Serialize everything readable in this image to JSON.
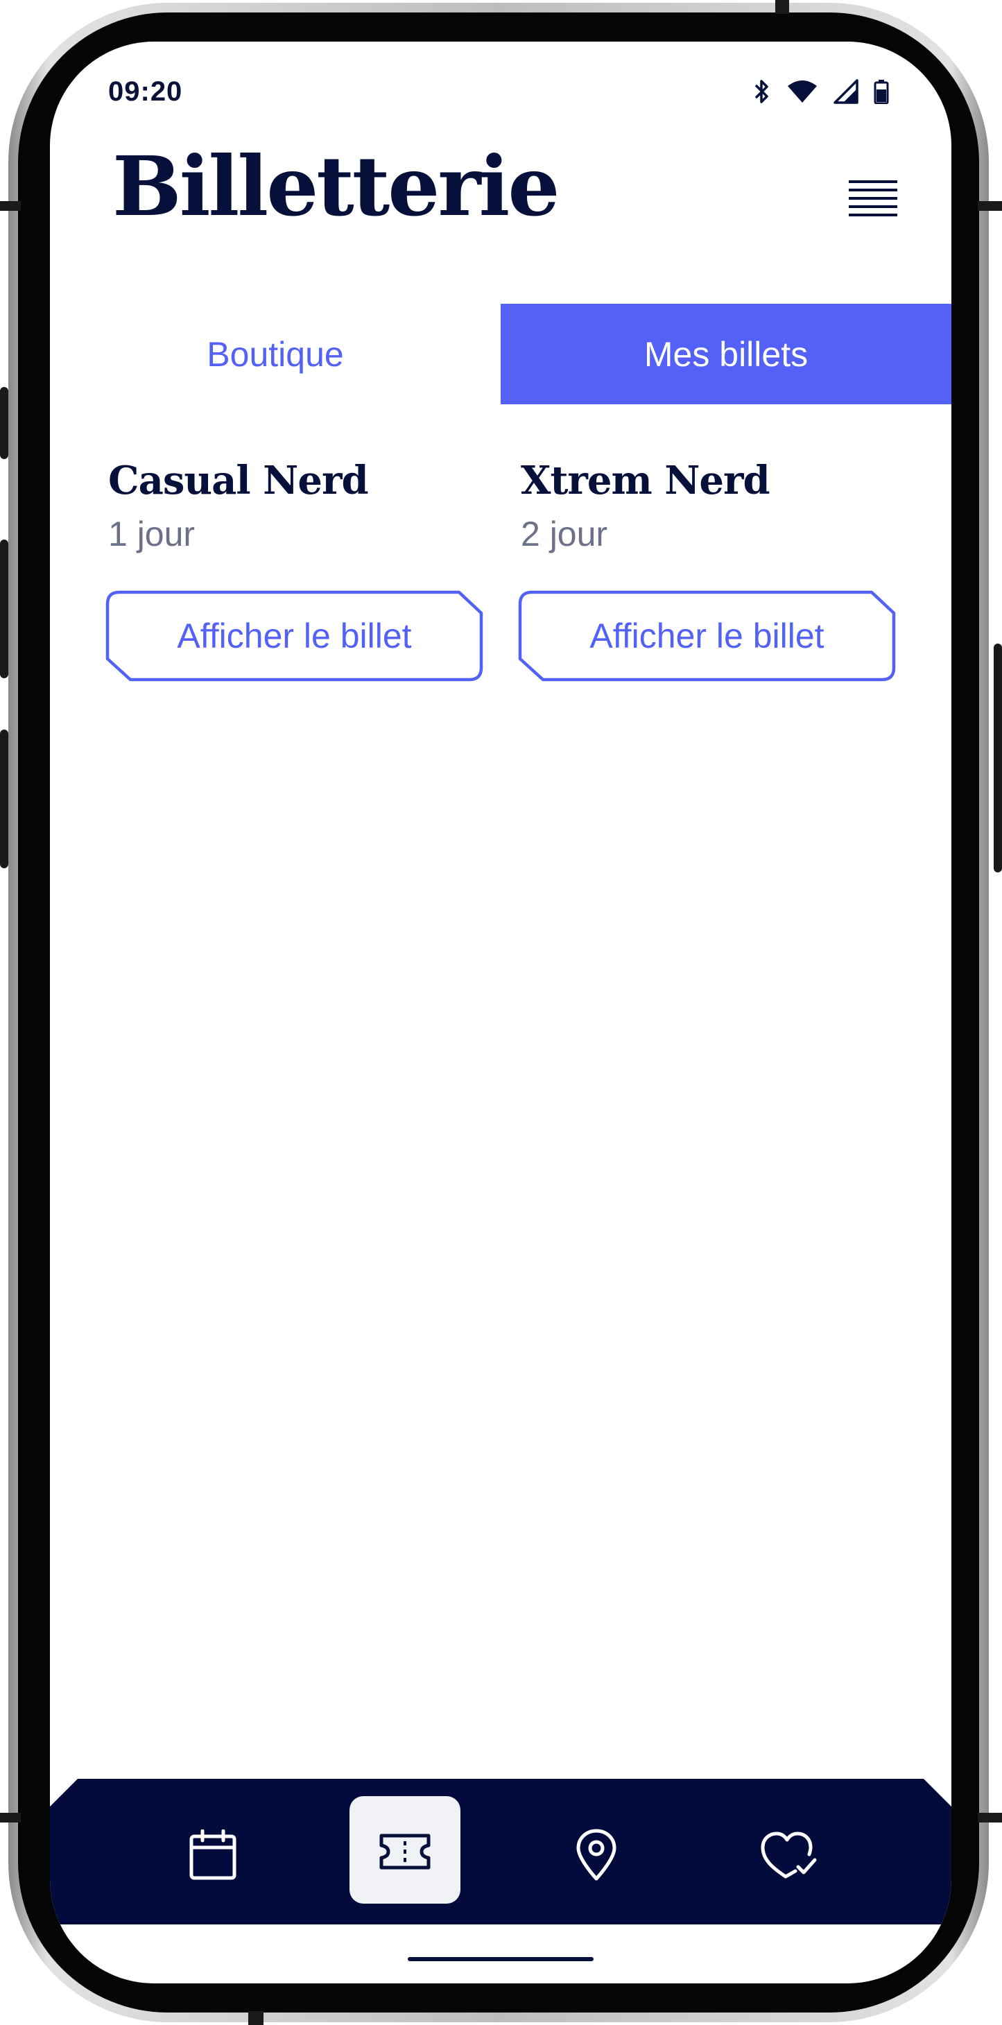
{
  "status_bar": {
    "time": "09:20",
    "icons": [
      "bluetooth-icon",
      "wifi-icon",
      "cellular-signal-icon",
      "battery-icon"
    ]
  },
  "header": {
    "title": "Billetterie",
    "menu_icon": "hamburger-menu-icon"
  },
  "tabs": [
    {
      "label": "Boutique",
      "active": false
    },
    {
      "label": "Mes billets",
      "active": true
    }
  ],
  "tickets": [
    {
      "name": "Casual Nerd",
      "duration": "1 jour",
      "button_label": "Afficher le billet"
    },
    {
      "name": "Xtrem Nerd",
      "duration": "2 jour",
      "button_label": "Afficher le billet"
    }
  ],
  "bottom_nav": [
    {
      "icon": "calendar-icon",
      "selected": false
    },
    {
      "icon": "ticket-icon",
      "selected": true
    },
    {
      "icon": "map-pin-icon",
      "selected": false
    },
    {
      "icon": "heart-check-icon",
      "selected": false
    }
  ],
  "colors": {
    "primary_dark": "#07103a",
    "accent": "#5361f6",
    "muted_text": "#6c7089",
    "nav_background": "#020b3b",
    "selected_nav_bg": "#f1f2f6"
  }
}
